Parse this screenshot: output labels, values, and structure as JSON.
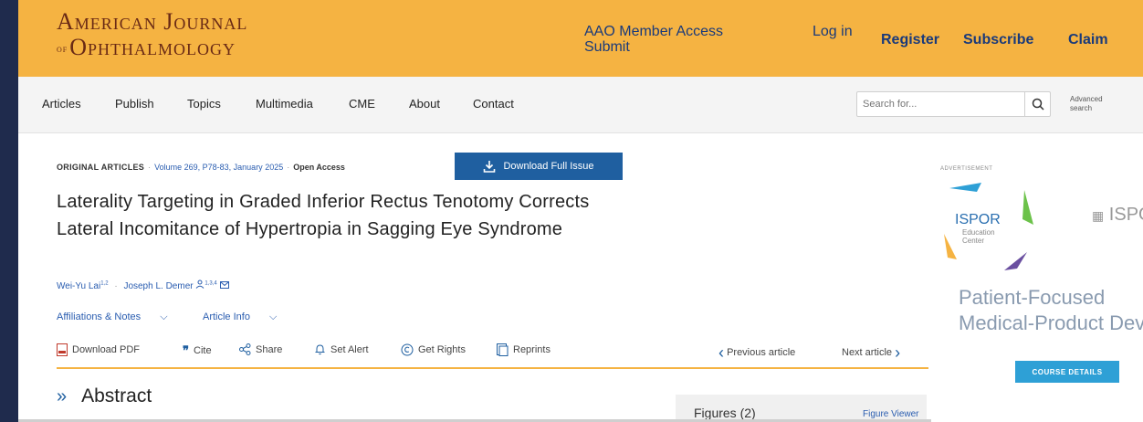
{
  "colors": {
    "topbar": "#f5b342",
    "brand": "#6a2a15",
    "link": "#2a5db0",
    "button": "#1f5fa0"
  },
  "header": {
    "logo_line1": "American Journal",
    "logo_of": "of",
    "logo_line2": "Ophthalmology",
    "aao_access": "AAO Member Access",
    "submit": "Submit",
    "login": "Log in",
    "register": "Register",
    "subscribe": "Subscribe",
    "claim": "Claim"
  },
  "nav": {
    "items": [
      "Articles",
      "Publish",
      "Topics",
      "Multimedia",
      "CME",
      "About",
      "Contact"
    ],
    "search_placeholder": "Search for...",
    "advanced_search": "Advanced search"
  },
  "article": {
    "section": "ORIGINAL ARTICLES",
    "volume": "Volume 269, P78-83, January 2025",
    "access": "Open Access",
    "download_issue": "Download Full Issue",
    "title": "Laterality Targeting in Graded Inferior Rectus Tenotomy Corrects Lateral Incomitance of Hypertropia in Sagging Eye Syndrome",
    "author1": "Wei-Yu Lai",
    "author1_sup": "1,2",
    "author2": "Joseph L. Demer",
    "author2_sup": "1,3,4",
    "affiliations": "Affiliations & Notes",
    "article_info": "Article Info"
  },
  "toolbar": {
    "download_pdf": "Download PDF",
    "cite": "Cite",
    "share": "Share",
    "set_alert": "Set Alert",
    "get_rights": "Get Rights",
    "reprints": "Reprints",
    "previous": "Previous article",
    "next": "Next article"
  },
  "abstract": {
    "heading": "Abstract",
    "figures": "Figures (2)",
    "figure_viewer": "Figure Viewer"
  },
  "ad": {
    "label": "ADVERTISEMENT",
    "logo": "ISPOR",
    "logo_sub1": "Education",
    "logo_sub2": "Center",
    "logo2": "ISPOR",
    "headline1": "Patient-Focused",
    "headline2": "Medical-Product Development",
    "button": "COURSE DETAILS"
  }
}
